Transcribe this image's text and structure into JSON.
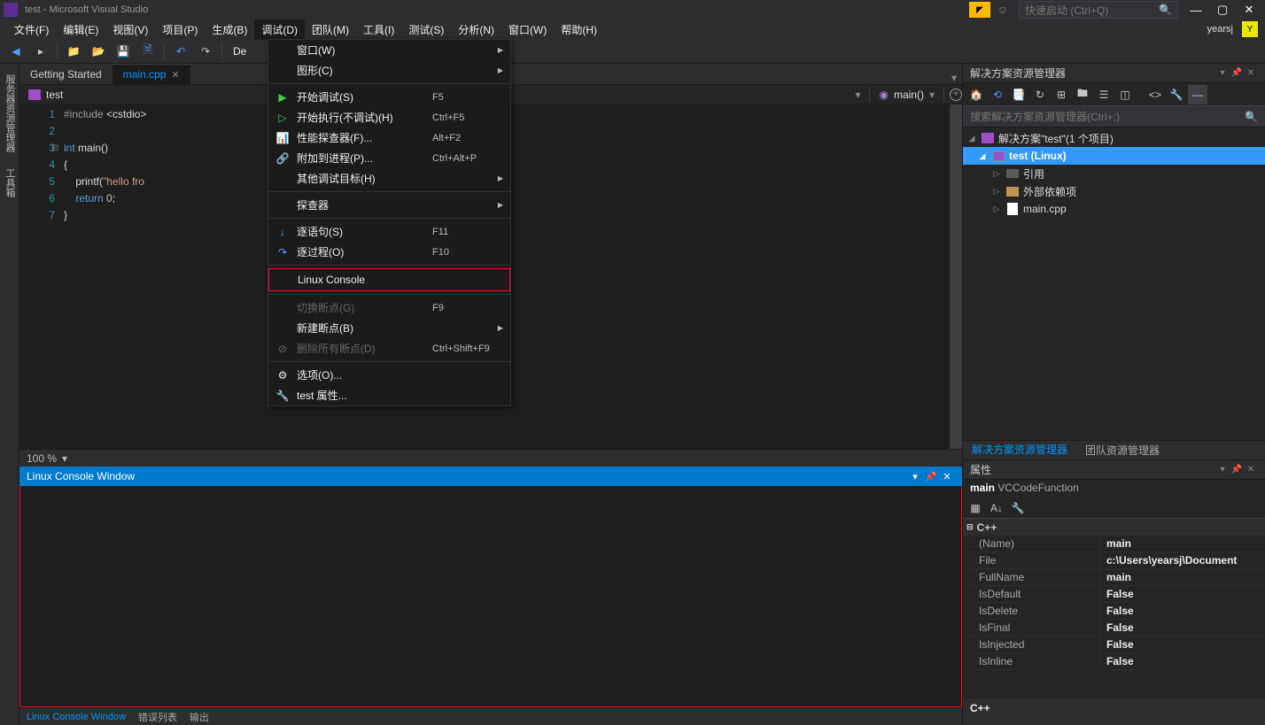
{
  "title": "test - Microsoft Visual Studio",
  "quicklaunch": "快速启动 (Ctrl+Q)",
  "account": "yearsj",
  "avatarLetter": "Y",
  "menu": {
    "file": "文件(F)",
    "edit": "编辑(E)",
    "view": "视图(V)",
    "project": "项目(P)",
    "build": "生成(B)",
    "debug": "调试(D)",
    "team": "团队(M)",
    "tools": "工具(I)",
    "test": "测试(S)",
    "analyze": "分析(N)",
    "window": "窗口(W)",
    "help": "帮助(H)"
  },
  "toolbar": {
    "config": "De"
  },
  "leftRail": {
    "server": "服务器资源管理器",
    "toolbox": "工具箱"
  },
  "tabs": {
    "getting": "Getting Started",
    "main": "main.cpp"
  },
  "nav": {
    "scope": "test",
    "member": "main()"
  },
  "code": {
    "l1": "#include <cstdio>",
    "l3a": "int",
    "l3b": " main()",
    "l4": "{",
    "l5a": "    printf(",
    "l5b": "\"hello fro",
    "l6a": "    return ",
    "l6b": "0",
    "l6c": ";",
    "l7": "}"
  },
  "editorStatus": "100 %",
  "console": {
    "title": "Linux Console Window"
  },
  "bottomTabs": {
    "console": "Linux Console Window",
    "errors": "错误列表",
    "output": "输出"
  },
  "dd": {
    "window": "窗口(W)",
    "graphics": "图形(C)",
    "start": "开始调试(S)",
    "startKey": "F5",
    "startNo": "开始执行(不调试)(H)",
    "startNoKey": "Ctrl+F5",
    "perf": "性能探查器(F)...",
    "perfKey": "Alt+F2",
    "attach": "附加到进程(P)...",
    "attachKey": "Ctrl+Alt+P",
    "other": "其他调试目标(H)",
    "profiler": "探查器",
    "stepInto": "逐语句(S)",
    "stepIntoKey": "F11",
    "stepOver": "逐过程(O)",
    "stepOverKey": "F10",
    "linux": "Linux Console",
    "toggleBp": "切换断点(G)",
    "toggleBpKey": "F9",
    "newBp": "新建断点(B)",
    "delBp": "删除所有断点(D)",
    "delBpKey": "Ctrl+Shift+F9",
    "options": "选项(O)...",
    "props": "test 属性..."
  },
  "sln": {
    "title": "解决方案资源管理器",
    "search": "搜索解决方案资源管理器(Ctrl+;)",
    "root": "解决方案\"test\"(1 个项目)",
    "proj": "test (Linux)",
    "refs": "引用",
    "ext": "外部依赖项",
    "file": "main.cpp",
    "tabSln": "解决方案资源管理器",
    "tabTeam": "团队资源管理器"
  },
  "props": {
    "title": "属性",
    "obj": "main",
    "objType": "VCCodeFunction",
    "cat": "C++",
    "rows": [
      {
        "k": "(Name)",
        "v": "main"
      },
      {
        "k": "File",
        "v": "c:\\Users\\yearsj\\Document"
      },
      {
        "k": "FullName",
        "v": "main"
      },
      {
        "k": "IsDefault",
        "v": "False"
      },
      {
        "k": "IsDelete",
        "v": "False"
      },
      {
        "k": "IsFinal",
        "v": "False"
      },
      {
        "k": "IsInjected",
        "v": "False"
      },
      {
        "k": "IsInline",
        "v": "False"
      }
    ],
    "desc": "C++"
  }
}
